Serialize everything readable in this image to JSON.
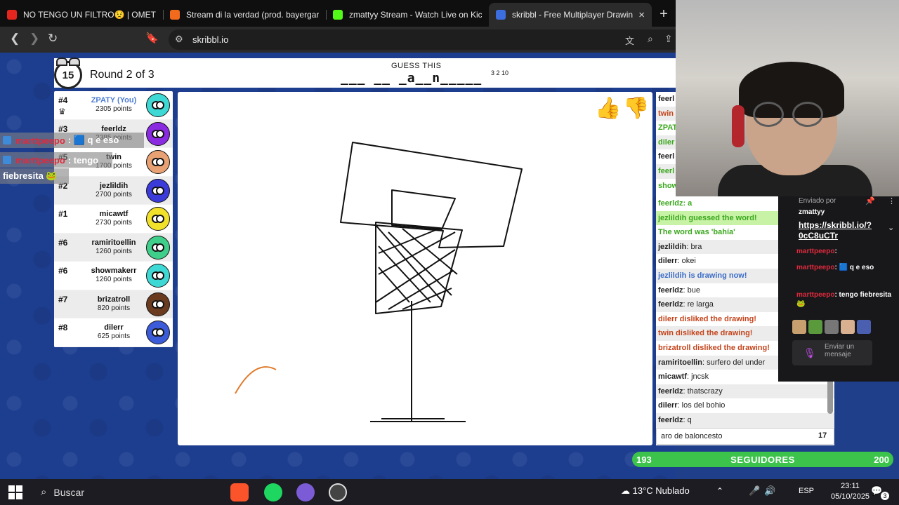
{
  "tabs": [
    {
      "title": "NO TENGO UN FILTRO😟 | OMETV -",
      "favicon_color": "#e5261f"
    },
    {
      "title": "Stream di la verdad (prod. bayergartn",
      "favicon_color": "#f26b1d"
    },
    {
      "title": "zmattyy Stream - Watch Live on Kick",
      "favicon_color": "#53fc18"
    },
    {
      "title": "skribbl - Free Multiplayer Drawin",
      "favicon_color": "#3d6ee0"
    }
  ],
  "browser": {
    "url": "skribbl.io",
    "close_icon": "×",
    "new_tab_icon": "+"
  },
  "game": {
    "timer": "15",
    "round": "Round 2 of 3",
    "guess_label": "GUESS THIS",
    "word": "___ __ _a__n_____",
    "word_lengths": "3 2 10"
  },
  "players": [
    {
      "rank": "#4",
      "name": "ZPATY (You)",
      "points": "2305 points",
      "you": true,
      "color": "#3fd9d5"
    },
    {
      "rank": "#3",
      "name": "feerldz",
      "points": "2385 points",
      "color": "#8a2be2"
    },
    {
      "rank": "#5",
      "name": "twin",
      "points": "1700 points",
      "color": "#e8a173"
    },
    {
      "rank": "#2",
      "name": "jezlildih",
      "points": "2700 points",
      "color": "#3b3bd9"
    },
    {
      "rank": "#1",
      "name": "micawtf",
      "points": "2730 points",
      "color": "#f2e12b"
    },
    {
      "rank": "#6",
      "name": "ramiritoellin",
      "points": "1260 points",
      "color": "#3fcf8a"
    },
    {
      "rank": "#6",
      "name": "showmakerr",
      "points": "1260 points",
      "color": "#3fd9d5"
    },
    {
      "rank": "#7",
      "name": "brizatroll",
      "points": "820 points",
      "color": "#6b3b20"
    },
    {
      "rank": "#8",
      "name": "dilerr",
      "points": "625 points",
      "color": "#3b5bd9"
    }
  ],
  "overlay_chat": [
    {
      "user": "marttpeepo",
      "text": ": 🟦 q e eso"
    },
    {
      "user": "marttpeepo",
      "text": ": tengo"
    },
    {
      "user": "",
      "text": "fiebresita 🐸"
    }
  ],
  "chat_stub": [
    "feerl",
    "twin",
    "ZPAT",
    "diler",
    "feerl",
    "feerl",
    "show"
  ],
  "chat": [
    {
      "text": "feerldz: a",
      "style": "green"
    },
    {
      "text": "jezlildih guessed the word!",
      "style": "green greenbg"
    },
    {
      "text": "The word was 'bahía'",
      "style": "green"
    },
    {
      "user": "jezlildih",
      "text": ": bra"
    },
    {
      "user": "dilerr",
      "text": ": okei"
    },
    {
      "text": "jezlildih is drawing now!",
      "style": "blue"
    },
    {
      "user": "feerldz",
      "text": ": bue"
    },
    {
      "user": "feerldz",
      "text": ": re larga"
    },
    {
      "text": "dilerr disliked the drawing!",
      "style": "red"
    },
    {
      "text": "twin disliked the drawing!",
      "style": "red"
    },
    {
      "text": "brizatroll disliked the drawing!",
      "style": "red"
    },
    {
      "user": "ramiritoellin",
      "text": ": surfero del under"
    },
    {
      "user": "micawtf",
      "text": ": jncsk"
    },
    {
      "user": "feerldz",
      "text": ": thatscrazy"
    },
    {
      "user": "dilerr",
      "text": ": los del bohio"
    },
    {
      "user": "feerldz",
      "text": ": q"
    }
  ],
  "chat_input": {
    "value": "aro de baloncesto",
    "count": "17"
  },
  "twitch": {
    "sent_by": "Enviado por",
    "pinned_user": "zmattyy",
    "pinned_link": "https://skribbl.io/?0cC8uCTr",
    "messages": [
      {
        "user": "marttpeepo",
        "text": ":"
      },
      {
        "user": "marttpeepo",
        "text": ": 🟦 q e eso"
      },
      {
        "user": "marttpeepo",
        "text": ": tengo fiebresita 🐸"
      }
    ],
    "input_placeholder": "Enviar un mensaje"
  },
  "followers": {
    "current": "193",
    "label": "SEGUIDORES",
    "goal": "200"
  },
  "taskbar": {
    "search": "Buscar",
    "weather": "13°C  Nublado",
    "lang": "ESP",
    "time": "23:11",
    "date": "05/10/2025",
    "notif_badge": "3"
  },
  "colors": {
    "page_bg": "#1d3e8f",
    "chat_green": "#3aa81d",
    "chat_red": "#c4451c",
    "chat_blue": "#3a6cc9",
    "follower_bar": "#3bc34b"
  }
}
